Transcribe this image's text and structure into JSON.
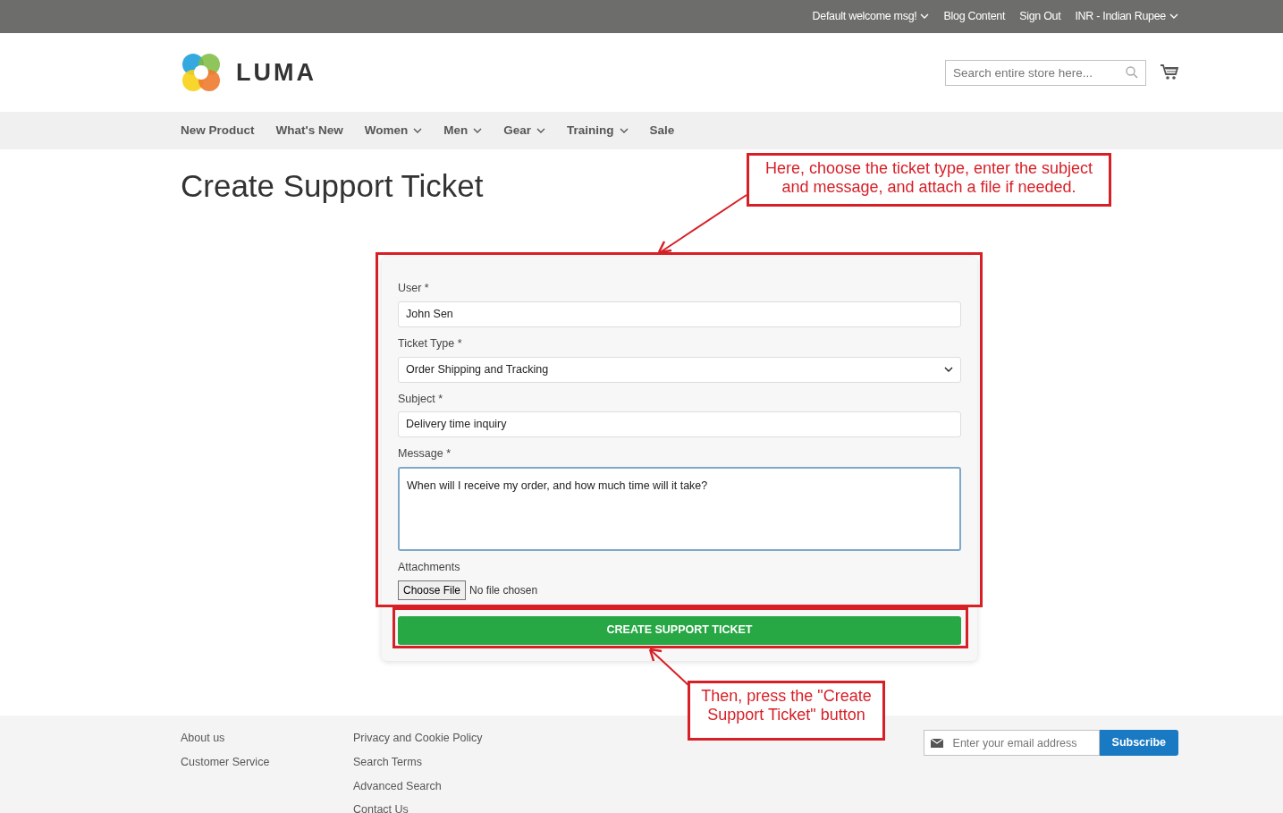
{
  "top_bar": {
    "links": [
      {
        "label": "Default welcome msg!",
        "has_caret": true
      },
      {
        "label": "Blog Content",
        "has_caret": false
      },
      {
        "label": "Sign Out",
        "has_caret": false
      },
      {
        "label": "INR - Indian Rupee",
        "has_caret": true
      }
    ]
  },
  "header": {
    "logo_text": "LUMA",
    "search": {
      "placeholder": "Search entire store here..."
    }
  },
  "nav": [
    {
      "label": "New Product",
      "has_dropdown": false
    },
    {
      "label": "What's New",
      "has_dropdown": false
    },
    {
      "label": "Women",
      "has_dropdown": true
    },
    {
      "label": "Men",
      "has_dropdown": true
    },
    {
      "label": "Gear",
      "has_dropdown": true
    },
    {
      "label": "Training",
      "has_dropdown": true
    },
    {
      "label": "Sale",
      "has_dropdown": false
    }
  ],
  "page_title": "Create Support Ticket",
  "form": {
    "fields": [
      {
        "kind": "text",
        "label": "User *",
        "value": "John Sen"
      },
      {
        "kind": "select",
        "label": "Ticket Type *",
        "value": "Order Shipping and Tracking"
      },
      {
        "kind": "text",
        "label": "Subject *",
        "value": "Delivery time inquiry"
      },
      {
        "kind": "textarea",
        "label": "Message *",
        "value": "When will I receive my order, and how much time will it take?"
      },
      {
        "kind": "file",
        "label": "Attachments",
        "button": "Choose File",
        "value": "No file chosen"
      }
    ],
    "submit": "CREATE SUPPORT TICKET"
  },
  "annotations": [
    {
      "text": "Here, choose the ticket type, enter the subject and message, and attach a file if needed."
    },
    {
      "text": "Then, press the \"Create Support Ticket\" button"
    }
  ],
  "footer": {
    "columns": [
      [
        "About us",
        "Customer Service"
      ],
      [
        "Privacy and Cookie Policy",
        "Search Terms",
        "Advanced Search",
        "Contact Us"
      ]
    ],
    "newsletter": {
      "placeholder": "Enter your email address",
      "button": "Subscribe"
    }
  }
}
